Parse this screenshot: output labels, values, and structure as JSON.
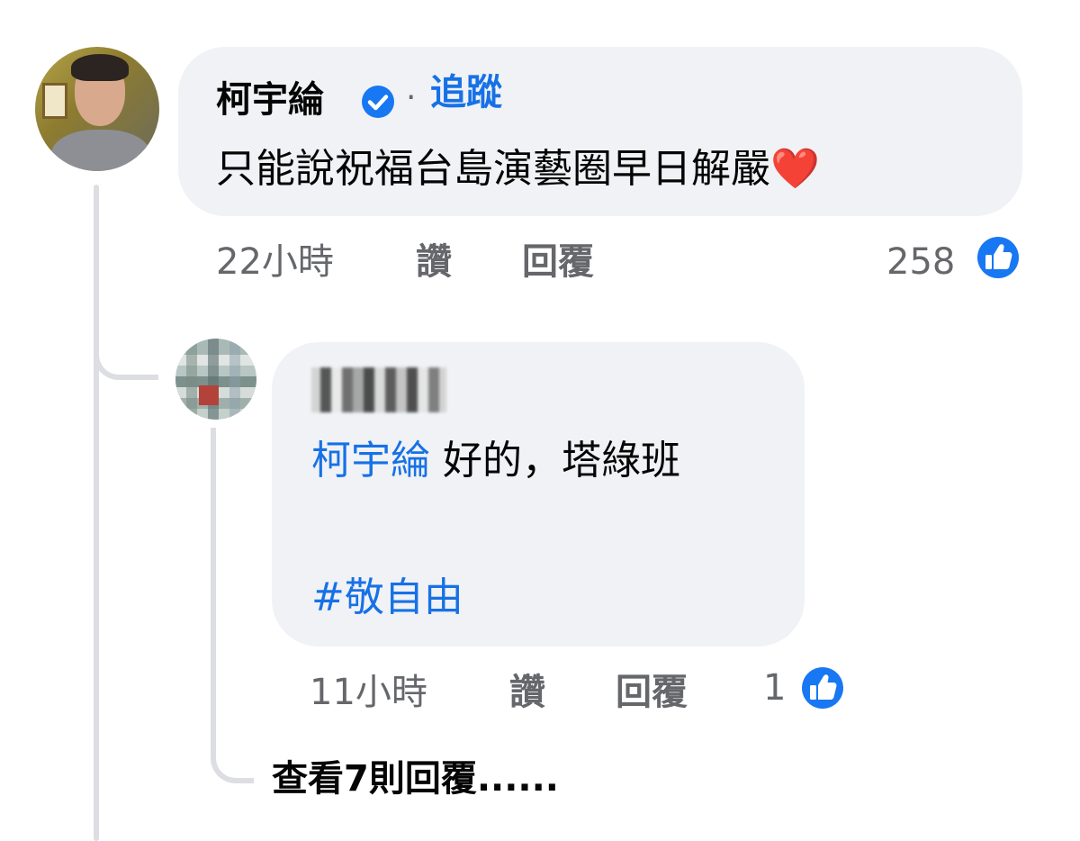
{
  "comment": {
    "author": "柯宇綸",
    "separator": "·",
    "follow_label": "追蹤",
    "text": "只能說祝福台島演藝圈早日解嚴",
    "heart": "❤️",
    "time": "22小時",
    "like_label": "讚",
    "reply_label": "回覆",
    "like_count": "258",
    "icons": {
      "verified": "verified-badge-icon",
      "like": "thumbs-up-icon"
    }
  },
  "reply": {
    "mention": "柯宇綸",
    "text": " 好的，塔綠班",
    "hashtag": "#敬自由",
    "time": "11小時",
    "like_label": "讚",
    "reply_label": "回覆",
    "like_count": "1"
  },
  "view_more_replies": "查看7則回覆......",
  "colors": {
    "link_blue": "#1771e6",
    "bubble_bg": "#f0f2f5",
    "secondary_text": "#65676b",
    "like_blue": "#1877f2"
  }
}
